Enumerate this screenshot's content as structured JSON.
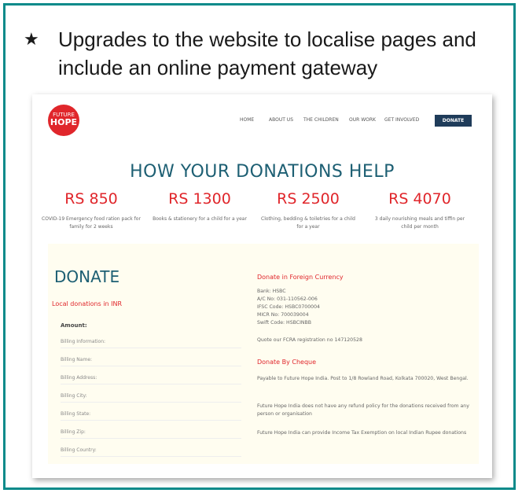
{
  "slide": {
    "bullet_icon": "star-icon",
    "bullet_text": "Upgrades to the website to localise pages and include an online payment gateway"
  },
  "website": {
    "logo": {
      "line1": "FUTURE",
      "line2": "HOPE"
    },
    "nav": [
      "HOME",
      "ABOUT US",
      "THE CHILDREN",
      "OUR WORK",
      "GET INVOLVED"
    ],
    "donate_button": "DONATE",
    "help_title": "HOW YOUR DONATIONS HELP",
    "tiers": [
      {
        "amount": "RS 850",
        "desc": "COVID-19 Emergency food ration pack for family for 2 weeks"
      },
      {
        "amount": "RS 1300",
        "desc": "Books & stationery for a child for a year"
      },
      {
        "amount": "RS 2500",
        "desc": "Clothing, bedding & toiletries for a child for a year"
      },
      {
        "amount": "RS 4070",
        "desc": "3 daily nourishing meals and tiffin per child per month"
      }
    ],
    "donate_section": {
      "title": "DONATE",
      "local_title": "Local donations in INR",
      "amount_label": "Amount:",
      "billing_fields": [
        "Billing Information:",
        "Billing Name:",
        "Billing Address:",
        "Billing City:",
        "Billing State:",
        "Billing Zip:",
        "Billing Country:"
      ]
    },
    "foreign": {
      "title": "Donate in Foreign Currency",
      "bank": "Bank: HSBC",
      "account": "A/C No: 031-110562-006",
      "ifsc": "IFSC Code: HSBC0700004",
      "micr": "MICR No: 700039004",
      "swift": "Swift Code: HSBCINBB",
      "fcra": "Quote our FCRA registration no 147120528"
    },
    "cheque": {
      "title": "Donate By Cheque",
      "payable": "Payable to Future Hope India. Post to 1/8 Rowland Road, Kolkata 700020, West Bengal.",
      "refund": "Future Hope India does not have any refund policy for the donations received from any person or organisation",
      "tax": "Future Hope India can provide Income Tax Exemption on local Indian Rupee donations"
    }
  }
}
